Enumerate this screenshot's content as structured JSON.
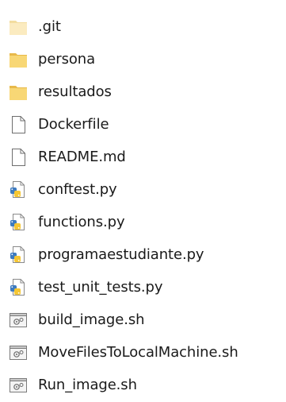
{
  "explorer": {
    "items": [
      {
        "name": ".git",
        "icon": "hidden-folder-icon"
      },
      {
        "name": "persona",
        "icon": "folder-icon"
      },
      {
        "name": "resultados",
        "icon": "folder-icon"
      },
      {
        "name": "Dockerfile",
        "icon": "blank-file-icon"
      },
      {
        "name": "README.md",
        "icon": "blank-file-icon"
      },
      {
        "name": "conftest.py",
        "icon": "python-file-icon"
      },
      {
        "name": "functions.py",
        "icon": "python-file-icon"
      },
      {
        "name": "programaestudiante.py",
        "icon": "python-file-icon"
      },
      {
        "name": "test_unit_tests.py",
        "icon": "python-file-icon"
      },
      {
        "name": "build_image.sh",
        "icon": "shell-script-icon"
      },
      {
        "name": "MoveFilesToLocalMachine.sh",
        "icon": "shell-script-icon"
      },
      {
        "name": "Run_image.sh",
        "icon": "shell-script-icon"
      }
    ]
  },
  "colors": {
    "folder": "#F8D775",
    "folder_dark": "#E8B94A",
    "hidden_folder": "#FBEBC0",
    "python_blue": "#3E7BBF",
    "python_yellow": "#F5C633",
    "text": "#1a1a1a"
  }
}
